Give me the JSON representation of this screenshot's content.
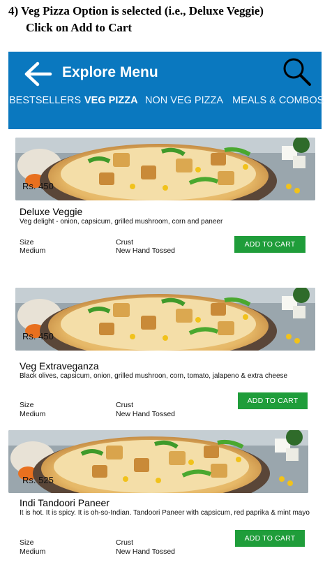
{
  "instruction": {
    "line1": "4) Veg Pizza Option is selected (i.e., Deluxe Veggie)",
    "line2": "Click on Add to Cart"
  },
  "header": {
    "title": "Explore Menu",
    "back_icon": "back-arrow-icon",
    "search_icon": "search-icon",
    "bg_color": "#0a78bf"
  },
  "tabs": [
    {
      "label": "BESTSELLERS"
    },
    {
      "label": "VEG PIZZA",
      "active": true
    },
    {
      "label": "NON VEG PIZZA"
    },
    {
      "label": "MEALS & COMBOS"
    }
  ],
  "products": [
    {
      "price": "Rs. 450",
      "name": "Deluxe Veggie",
      "description": "Veg delight - onion, capsicum, grilled mushroom, corn and paneer",
      "size_label": "Size",
      "size_value": "Medium",
      "crust_label": "Crust",
      "crust_value": "New Hand Tossed",
      "button": "ADD TO CART"
    },
    {
      "price": "Rs. 450",
      "name": "Veg Extraveganza",
      "description": "Black olives, capsicum, onion, grilled mushroon, corn, tomato, jalapeno & extra cheese",
      "size_label": "Size",
      "size_value": "Medium",
      "crust_label": "Crust",
      "crust_value": "New Hand Tossed",
      "button": "ADD TO CART"
    },
    {
      "price": "Rs. 525",
      "name": "Indi Tandoori Paneer",
      "description": "It is hot. It is spicy. It is oh-so-Indian. Tandoori Paneer with capsicum, red paprika & mint mayo",
      "size_label": "Size",
      "size_value": "Medium",
      "crust_label": "Crust",
      "crust_value": "New Hand Tossed",
      "button": "ADD TO CART"
    }
  ],
  "colors": {
    "accent": "#1f9d3a"
  }
}
